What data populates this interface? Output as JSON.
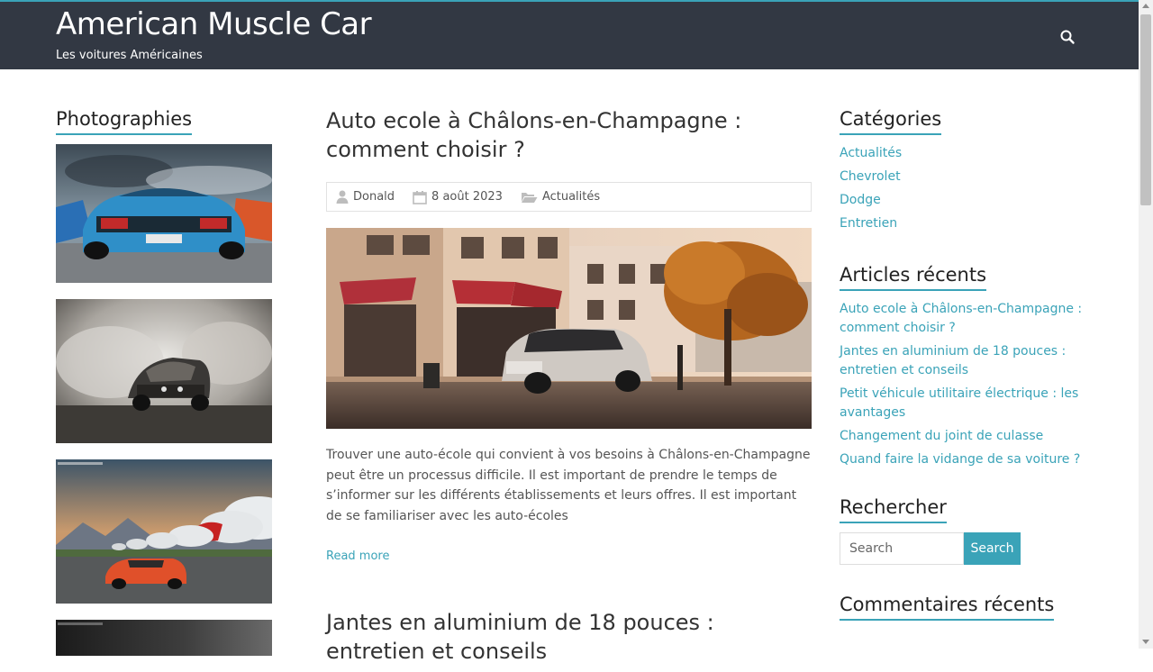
{
  "header": {
    "site_title": "American Muscle Car",
    "tagline": "Les voitures Américaines"
  },
  "colors": {
    "accent": "#3aa3b8",
    "header_bg": "#323843"
  },
  "left_sidebar": {
    "title": "Photographies"
  },
  "posts": [
    {
      "title": "Auto ecole à Châlons-en-Champagne : comment choisir ?",
      "author": "Donald",
      "date": "8 août 2023",
      "category": "Actualités",
      "excerpt": "Trouver une auto-école qui convient à vos besoins à Châlons-en-Champagne peut être un processus difficile. Il est important de prendre le temps de s’informer sur les différents établissements et leurs offres. Il est important de se familiariser avec les auto-écoles",
      "read_more": "Read more"
    },
    {
      "title": "Jantes en aluminium de 18 pouces : entretien et conseils"
    }
  ],
  "right_sidebar": {
    "categories": {
      "title": "Catégories",
      "items": [
        "Actualités",
        "Chevrolet",
        "Dodge",
        "Entretien"
      ]
    },
    "recent": {
      "title": "Articles récents",
      "items": [
        "Auto ecole à Châlons-en-Champagne : comment choisir ?",
        "Jantes en aluminium de 18 pouces : entretien et conseils",
        "Petit véhicule utilitaire électrique : les avantages",
        "Changement du joint de culasse",
        "Quand faire la vidange de sa voiture ?"
      ]
    },
    "search": {
      "title": "Rechercher",
      "placeholder": "Search",
      "button": "Search"
    },
    "comments": {
      "title": "Commentaires récents"
    }
  }
}
